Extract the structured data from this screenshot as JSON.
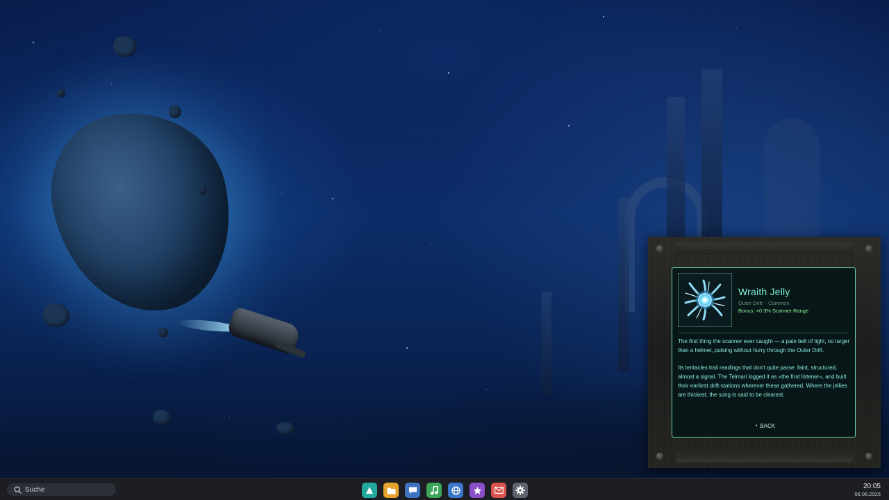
{
  "creature_card": {
    "name": "Wraith Jelly",
    "region": "Outer Drift",
    "rarity": "Common",
    "separator": "·",
    "bonus": "Bonus: +0.3% Scanner Range",
    "paragraphs": [
      "The first thing the scanner ever caught — a pale bell of light, no larger than a helmet, pulsing without hurry through the Outer Drift.",
      "Its tentacles trail readings that don't quite parse: faint, structured, almost a signal. The Telmari logged it as »the first listener«, and built their earliest drift-stations wherever these gathered. Where the jellies are thickest, the song is said to be clearest."
    ],
    "back_label": "BACK",
    "back_bullet": "•",
    "accent_color": "#6fd6b0",
    "name_color": "#7ef0d6",
    "bonus_color": "#8ff29a",
    "portrait_icon": "jellyfish-icon"
  },
  "taskbar": {
    "search_placeholder": "Suche",
    "search_icon": "search-icon",
    "apps": [
      {
        "name": "maps-app",
        "icon": "triangle-icon",
        "color": "#22a99b"
      },
      {
        "name": "files-app",
        "icon": "folder-icon",
        "color": "#e4a42b"
      },
      {
        "name": "messages-app",
        "icon": "chat-icon",
        "color": "#3f74c2"
      },
      {
        "name": "music-app",
        "icon": "music-note-icon",
        "color": "#3ea65b"
      },
      {
        "name": "browser-app",
        "icon": "globe-icon",
        "color": "#3a77c9"
      },
      {
        "name": "favorites-app",
        "icon": "star-icon",
        "color": "#8a4fc9"
      },
      {
        "name": "mail-app",
        "icon": "mail-icon",
        "color": "#d9534f"
      },
      {
        "name": "settings-app",
        "icon": "gear-icon",
        "color": "#5d6470"
      }
    ],
    "clock": {
      "time": "20:05",
      "date": "06.06.2026"
    }
  }
}
